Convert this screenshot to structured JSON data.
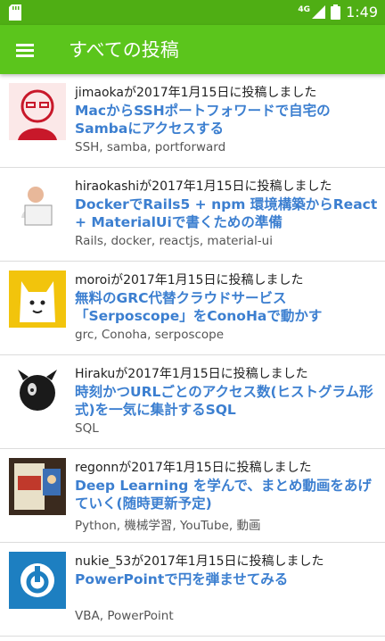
{
  "status": {
    "network": "4G",
    "time": "1:49"
  },
  "appbar": {
    "title": "すべての投稿"
  },
  "posts": [
    {
      "meta": "jimaokaが2017年1月15日に投稿しました",
      "title": "MacからSSHポートフォワードで自宅のSambaにアクセスする",
      "tags": "SSH, samba, portforward"
    },
    {
      "meta": "hiraokashiが2017年1月15日に投稿しました",
      "title": "DockerでRails5 + npm 環境構築からReact + MaterialUiで書くための準備",
      "tags": "Rails, docker, reactjs, material-ui"
    },
    {
      "meta": "moroiが2017年1月15日に投稿しました",
      "title": "無料のGRC代替クラウドサービス「Serposcope」をConoHaで動かす",
      "tags": "grc, Conoha, serposcope"
    },
    {
      "meta": "Hirakuが2017年1月15日に投稿しました",
      "title": "時刻かつURLごとのアクセス数(ヒストグラム形式)を一気に集計するSQL",
      "tags": "SQL"
    },
    {
      "meta": "regonnが2017年1月15日に投稿しました",
      "title": "Deep Learning を学んで、まとめ動画をあげていく(随時更新予定)",
      "tags": "Python, 機械学習, YouTube, 動画"
    },
    {
      "meta": "nukie_53が2017年1月15日に投稿しました",
      "title": "PowerPointで円を弾ませてみる",
      "tags": "VBA, PowerPoint"
    }
  ]
}
